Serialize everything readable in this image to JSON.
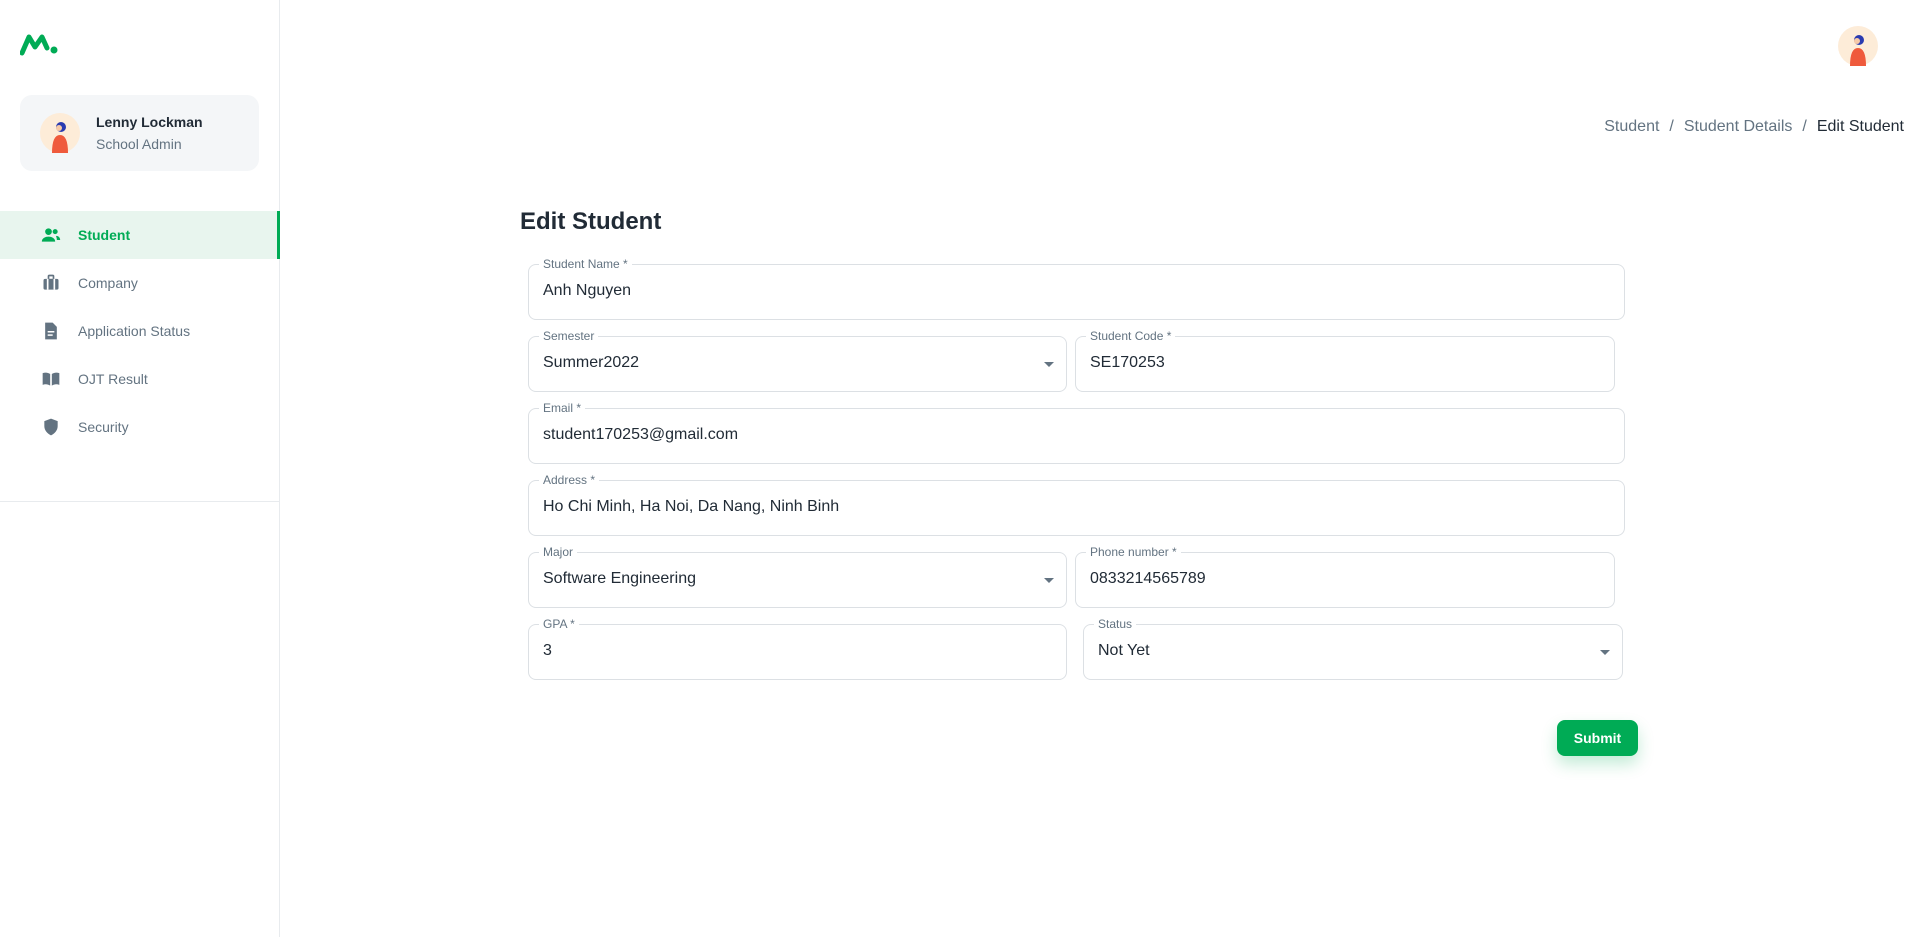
{
  "app": {
    "logo_icon": "logo-icon",
    "brand_color": "#00ab55"
  },
  "account": {
    "name": "Lenny Lockman",
    "role": "School Admin",
    "avatar_icon": "avatar-icon"
  },
  "sidebar": {
    "items": [
      {
        "label": "Student",
        "icon": "people-icon",
        "active": true
      },
      {
        "label": "Company",
        "icon": "briefcase-icon",
        "active": false
      },
      {
        "label": "Application Status",
        "icon": "document-icon",
        "active": false
      },
      {
        "label": "OJT Result",
        "icon": "book-icon",
        "active": false
      },
      {
        "label": "Security",
        "icon": "shield-icon",
        "active": false
      }
    ]
  },
  "breadcrumb": {
    "items": [
      "Student",
      "Student Details",
      "Edit Student"
    ],
    "separator": "/"
  },
  "form": {
    "title": "Edit Student",
    "fields": {
      "student_name": {
        "label": "Student Name *",
        "value": "Anh Nguyen"
      },
      "semester": {
        "label": "Semester",
        "value": "Summer2022"
      },
      "student_code": {
        "label": "Student Code *",
        "value": "SE170253"
      },
      "email": {
        "label": "Email *",
        "value": "student170253@gmail.com"
      },
      "address": {
        "label": "Address *",
        "value": "Ho Chi Minh, Ha Noi, Da Nang, Ninh Binh"
      },
      "major": {
        "label": "Major",
        "value": "Software Engineering"
      },
      "phone": {
        "label": "Phone number *",
        "value": "0833214565789"
      },
      "gpa": {
        "label": "GPA *",
        "value": "3"
      },
      "status": {
        "label": "Status",
        "value": "Not Yet"
      }
    },
    "submit_label": "Submit"
  }
}
